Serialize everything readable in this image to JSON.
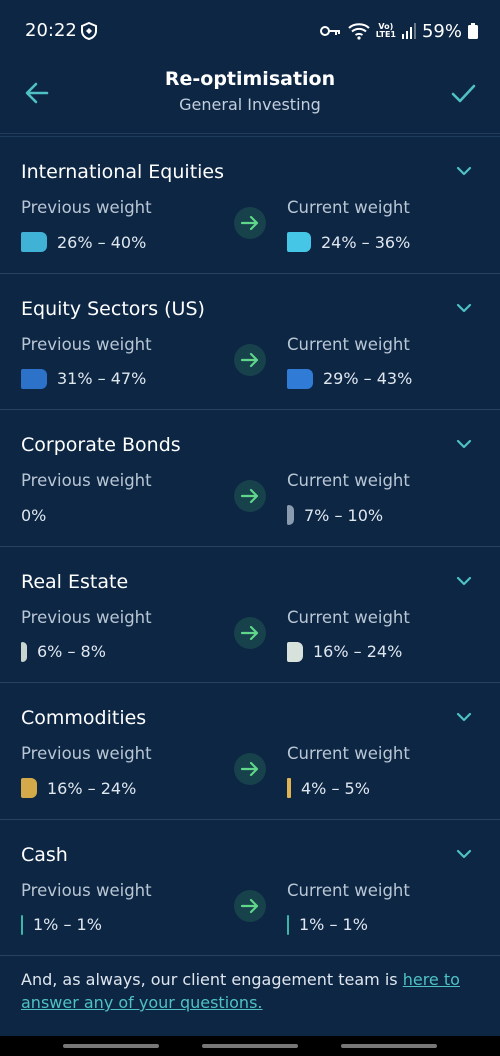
{
  "status_bar": {
    "time": "20:22",
    "volte_top": "Vo)",
    "volte_bottom": "LTE1",
    "battery": "59%"
  },
  "header": {
    "title": "Re-optimisation",
    "subtitle": "General Investing",
    "back_icon": "arrow-left-icon",
    "confirm_icon": "check-icon"
  },
  "sections": [
    {
      "title": "International Equities",
      "previous_label": "Previous weight",
      "previous_value": "26% – 40%",
      "previous_color": "#3fb2d6",
      "current_label": "Current weight",
      "current_value": "24% – 36%",
      "current_color": "#45c6e6"
    },
    {
      "title": "Equity Sectors (US)",
      "previous_label": "Previous weight",
      "previous_value": "31% – 47%",
      "previous_color": "#2d72c9",
      "current_label": "Current weight",
      "current_value": "29% – 43%",
      "current_color": "#2f7bd6"
    },
    {
      "title": "Corporate Bonds",
      "previous_label": "Previous weight",
      "previous_value": "0%",
      "previous_color": "",
      "current_label": "Current weight",
      "current_value": "7% – 10%",
      "current_color": "#8a9bb0"
    },
    {
      "title": "Real Estate",
      "previous_label": "Previous weight",
      "previous_value": "6% – 8%",
      "previous_color": "#c9d3cf",
      "current_label": "Current weight",
      "current_value": "16% – 24%",
      "current_color": "#d8e2dd"
    },
    {
      "title": "Commodities",
      "previous_label": "Previous weight",
      "previous_value": "16% – 24%",
      "previous_color": "#d4a94a",
      "current_label": "Current weight",
      "current_value": "4% – 5%",
      "current_color": "#e0b450"
    },
    {
      "title": "Cash",
      "previous_label": "Previous weight",
      "previous_value": "1% – 1%",
      "previous_color": "#3bb6a8",
      "current_label": "Current weight",
      "current_value": "1% – 1%",
      "current_color": "#3bb6a8"
    }
  ],
  "footer": {
    "text": "And, as always, our client engagement team is ",
    "link": "here to answer any of your questions."
  },
  "colors": {
    "background": "#0c2644",
    "accent": "#4fc1c4",
    "arrow_green": "#5fd68a"
  }
}
